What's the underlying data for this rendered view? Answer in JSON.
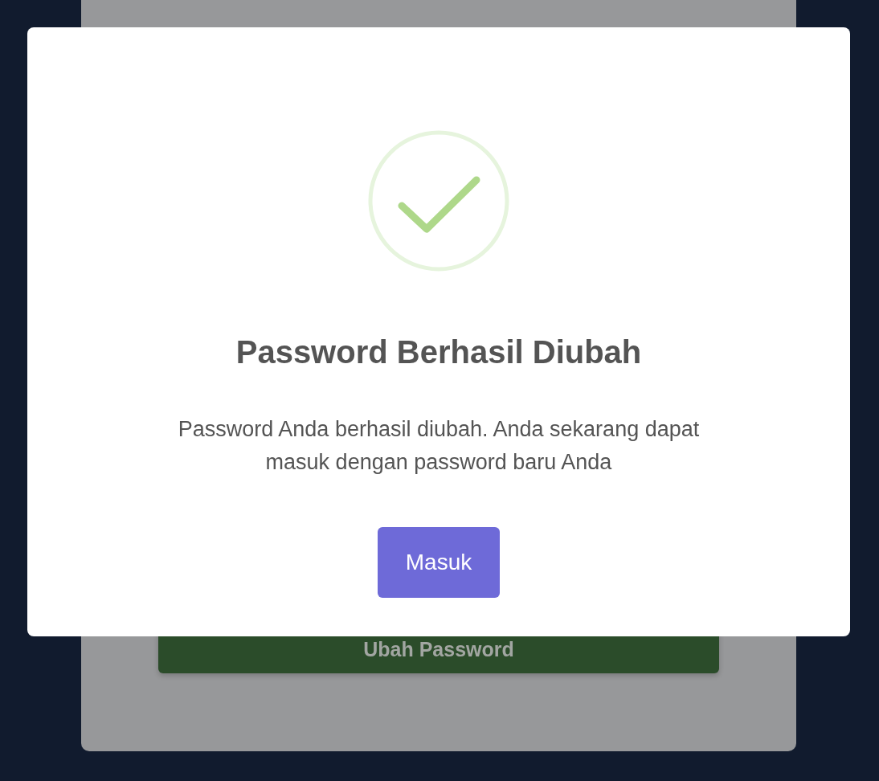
{
  "background_form": {
    "submit_button": "Ubah Password"
  },
  "dialog": {
    "kind": "success",
    "title": "Password Berhasil Diubah",
    "message": "Password Anda berhasil diubah. Anda sekarang dapat masuk dengan password baru Anda",
    "confirm_button": "Masuk"
  }
}
